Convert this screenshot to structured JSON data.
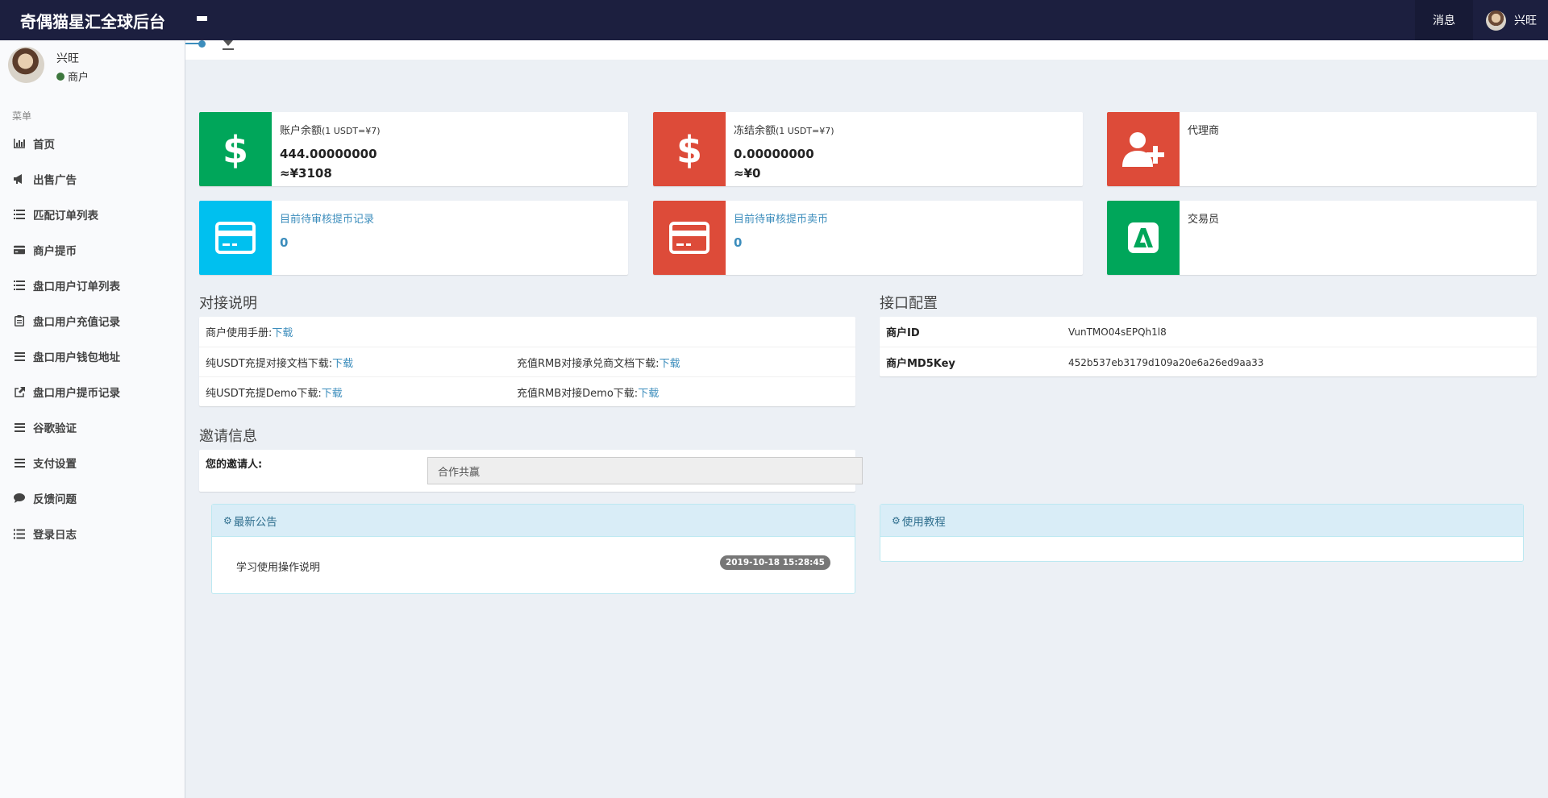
{
  "header": {
    "brand": "奇偶猫星汇全球后台",
    "messages_label": "消息",
    "username": "兴旺"
  },
  "sidebar": {
    "user": {
      "name": "兴旺",
      "role": "商户"
    },
    "menu_header": "菜单",
    "items": [
      {
        "label": "首页",
        "icon": "bar-chart-icon"
      },
      {
        "label": "出售广告",
        "icon": "bullhorn-icon"
      },
      {
        "label": "匹配订单列表",
        "icon": "list-icon"
      },
      {
        "label": "商户提币",
        "icon": "credit-card-icon"
      },
      {
        "label": "盘口用户订单列表",
        "icon": "list-icon"
      },
      {
        "label": "盘口用户充值记录",
        "icon": "clipboard-icon"
      },
      {
        "label": "盘口用户钱包地址",
        "icon": "bars-icon"
      },
      {
        "label": "盘口用户提币记录",
        "icon": "external-link-icon"
      },
      {
        "label": "谷歌验证",
        "icon": "bars-icon"
      },
      {
        "label": "支付设置",
        "icon": "bars-icon"
      },
      {
        "label": "反馈问题",
        "icon": "comment-icon"
      },
      {
        "label": "登录日志",
        "icon": "list-ol-icon"
      }
    ]
  },
  "infoboxes": {
    "balance": {
      "label": "账户余额",
      "rate": "(1 USDT=¥7)",
      "amount": "444.00000000",
      "cny": "≈¥3108",
      "icon": "dollar-icon",
      "color": "#00a65a"
    },
    "frozen": {
      "label": "冻结余额",
      "rate": "(1 USDT=¥7)",
      "amount": "0.00000000",
      "cny": "≈¥0",
      "icon": "dollar-icon",
      "color": "#dd4b39"
    },
    "agent": {
      "label": "代理商",
      "icon": "user-plus-icon",
      "color": "#dd4b39"
    },
    "pending_withdraw": {
      "label": "目前待审核提币记录",
      "count": "0",
      "icon": "credit-card-icon",
      "color": "#00c0ef"
    },
    "pending_sell": {
      "label": "目前待审核提币卖币",
      "count": "0",
      "icon": "credit-card-icon",
      "color": "#dd4b39"
    },
    "trader": {
      "label": "交易员",
      "icon": "letter-a-icon",
      "color": "#00a65a"
    }
  },
  "integration": {
    "title": "对接说明",
    "rows": [
      {
        "label": "商户使用手册:",
        "link": "下载"
      },
      {
        "label": "纯USDT充提对接文档下载:",
        "link": "下载",
        "label2": "充值RMB对接承兑商文档下载:",
        "link2": "下载"
      },
      {
        "label": "纯USDT充提Demo下载:",
        "link": "下载",
        "label2": "充值RMB对接Demo下载:",
        "link2": "下载"
      }
    ]
  },
  "api_config": {
    "title": "接口配置",
    "merchant_id_label": "商户ID",
    "merchant_id": "VunTMO04sEPQh1l8",
    "md5_label": "商户MD5Key",
    "md5": "452b537eb3179d109a20e6a26ed9aa33"
  },
  "invite": {
    "title": "邀请信息",
    "label": "您的邀请人:",
    "value": "合作共赢"
  },
  "notice_panel": {
    "title": "最新公告",
    "item": "学习使用操作说明",
    "date": "2019-10-18 15:28:45"
  },
  "tutorial_panel": {
    "title": "使用教程"
  }
}
